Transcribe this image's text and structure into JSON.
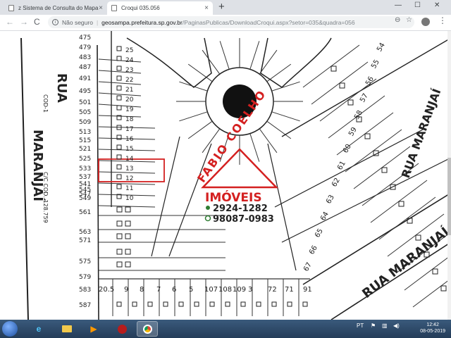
{
  "browser": {
    "tabs": [
      {
        "title": "z Sistema de Consulta do Mapa D",
        "close": "×"
      },
      {
        "title": "Croqui 035.056",
        "close": "×"
      }
    ],
    "new_tab": "+",
    "window_controls": {
      "minimize": "—",
      "maximize": "☐",
      "close": "✕"
    },
    "nav": {
      "back": "←",
      "forward": "→",
      "reload": "C"
    },
    "address": {
      "security": "Não seguro",
      "host": "geosampa.prefeitura.sp.gov.br",
      "path": "/PaginasPublicas/DownloadCroqui.aspx?setor=035&quadra=056"
    },
    "toolbar_icons": {
      "zoom": "⊖",
      "star": "☆",
      "menu": "⋮"
    }
  },
  "map": {
    "street_labels": [
      "RUA",
      "MARANJAÍ",
      "RUA MARANJAÍ",
      "RUA MARANJAÍ"
    ],
    "cod_labels": [
      "COD-1",
      "C/C COD. 128.759"
    ],
    "row_numbers": [
      "475",
      "479",
      "483",
      "487",
      "491",
      "495",
      "501",
      "505",
      "509",
      "513",
      "515",
      "521",
      "525",
      "533",
      "537",
      "541",
      "545",
      "547",
      "549",
      "561",
      "563",
      "571",
      "575",
      "579",
      "583",
      "587"
    ],
    "lot_numbers_left": [
      "25",
      "24",
      "23",
      "22",
      "21",
      "20",
      "19",
      "18",
      "17",
      "16",
      "15",
      "14",
      "13",
      "12",
      "11",
      "10"
    ],
    "lot_numbers_bottom": [
      "20.5",
      "9",
      "8",
      "7",
      "6",
      "5",
      "107",
      "108",
      "109",
      "3",
      "72",
      "71",
      "91"
    ],
    "lot_numbers_right": [
      "54",
      "55",
      "56",
      "57",
      "58",
      "59",
      "60",
      "61",
      "62",
      "63",
      "64",
      "65",
      "66",
      "67"
    ],
    "watermark": {
      "brand_top": "FABIO COELHO",
      "brand_main": "IMÓVEIS",
      "phone1": "2924-1282",
      "phone2": "98087-0983",
      "color": "#d42020",
      "phone_color": "#2e7d32"
    }
  },
  "taskbar": {
    "tray_lang": "PT",
    "clock_time": "12:42",
    "clock_date": "08-05-2019"
  }
}
